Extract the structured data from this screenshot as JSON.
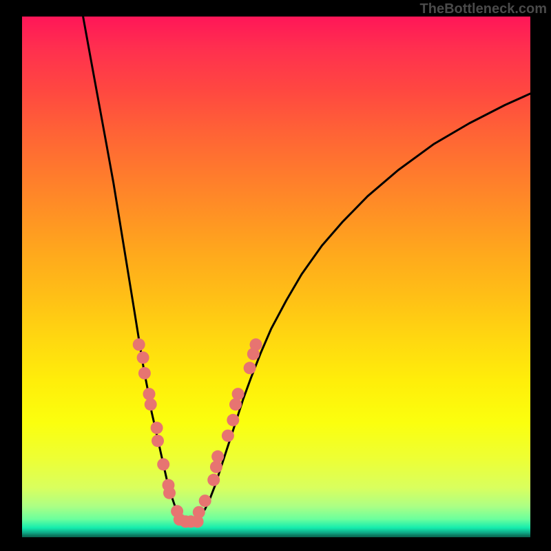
{
  "attribution": "TheBottleneck.com",
  "chart_data": {
    "type": "line",
    "title": "",
    "xlabel": "",
    "ylabel": "",
    "ylim": [
      0,
      100
    ],
    "xlim": [
      0,
      100
    ],
    "curve": {
      "comment": "Continuous black valley curve. x,y in plot-frame percent coordinates (0-100). y=0 is top of colored area, y=100 is bottom.",
      "points": [
        [
          12.0,
          0.0
        ],
        [
          13.5,
          8.0
        ],
        [
          15.0,
          16.0
        ],
        [
          16.5,
          24.0
        ],
        [
          18.0,
          32.0
        ],
        [
          19.0,
          38.0
        ],
        [
          20.0,
          44.0
        ],
        [
          21.0,
          50.0
        ],
        [
          22.0,
          56.0
        ],
        [
          23.0,
          62.0
        ],
        [
          24.0,
          68.0
        ],
        [
          24.8,
          72.0
        ],
        [
          25.5,
          76.0
        ],
        [
          26.2,
          79.0
        ],
        [
          27.0,
          82.5
        ],
        [
          27.8,
          86.0
        ],
        [
          28.5,
          89.0
        ],
        [
          29.2,
          91.5
        ],
        [
          30.0,
          93.8
        ],
        [
          31.0,
          95.5
        ],
        [
          32.0,
          96.4
        ],
        [
          33.0,
          96.7
        ],
        [
          34.0,
          96.6
        ],
        [
          35.0,
          96.0
        ],
        [
          36.0,
          94.6
        ],
        [
          37.0,
          92.5
        ],
        [
          38.0,
          90.0
        ],
        [
          39.0,
          87.0
        ],
        [
          40.0,
          84.0
        ],
        [
          41.0,
          81.0
        ],
        [
          42.0,
          78.0
        ],
        [
          43.5,
          73.5
        ],
        [
          45.0,
          69.5
        ],
        [
          47.0,
          64.5
        ],
        [
          49.0,
          60.0
        ],
        [
          52.0,
          54.5
        ],
        [
          55.0,
          49.5
        ],
        [
          59.0,
          44.0
        ],
        [
          63.0,
          39.5
        ],
        [
          68.0,
          34.5
        ],
        [
          74.0,
          29.5
        ],
        [
          81.0,
          24.5
        ],
        [
          88.0,
          20.5
        ],
        [
          95.0,
          17.0
        ],
        [
          100.0,
          14.8
        ]
      ]
    },
    "markers": {
      "comment": "Salmon-colored scatter points clustered near the valley. x,y in plot-frame percent.",
      "color": "#e77471",
      "radius_px": 9,
      "points": [
        [
          23.0,
          63.0
        ],
        [
          23.8,
          65.5
        ],
        [
          24.1,
          68.5
        ],
        [
          25.0,
          72.5
        ],
        [
          25.3,
          74.5
        ],
        [
          26.5,
          79.0
        ],
        [
          26.7,
          81.5
        ],
        [
          27.8,
          86.0
        ],
        [
          28.8,
          90.0
        ],
        [
          29.0,
          91.5
        ],
        [
          30.5,
          95.0
        ],
        [
          31.0,
          96.6
        ],
        [
          32.2,
          97.0
        ],
        [
          33.2,
          97.0
        ],
        [
          34.5,
          97.0
        ],
        [
          34.8,
          95.2
        ],
        [
          36.0,
          93.0
        ],
        [
          37.7,
          89.0
        ],
        [
          38.2,
          86.5
        ],
        [
          38.5,
          84.5
        ],
        [
          40.5,
          80.5
        ],
        [
          41.5,
          77.5
        ],
        [
          42.0,
          74.5
        ],
        [
          42.5,
          72.5
        ],
        [
          44.8,
          67.5
        ],
        [
          45.5,
          64.8
        ],
        [
          46.0,
          63.0
        ]
      ]
    },
    "gradient_scale": {
      "comment": "Vertical color gradient implies badness (red top) to goodness (green bottom), roughly 100..0.",
      "top_value": 100,
      "bottom_value": 0
    }
  }
}
